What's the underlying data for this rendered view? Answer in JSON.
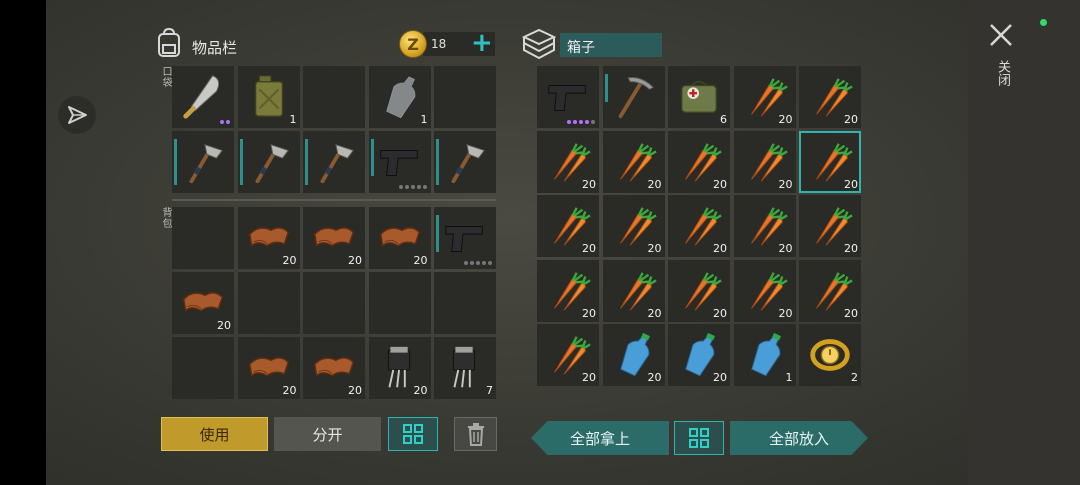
{
  "inventory": {
    "title": "物品栏",
    "coins": "18",
    "coin_symbol": "Z",
    "pocket_label": "口袋",
    "backpack_label": "背包",
    "pockets": [
      {
        "icon": "machete-icon",
        "dots": [
          "p",
          "p"
        ]
      },
      {
        "icon": "jerrycan-icon",
        "count": "1"
      },
      {
        "icon": "empty"
      },
      {
        "icon": "water-bottle-empty-icon",
        "count": "1"
      },
      {
        "icon": "empty"
      },
      {
        "icon": "hatchet-icon",
        "durability": 1.0
      },
      {
        "icon": "hatchet-icon",
        "durability": 1.0
      },
      {
        "icon": "hatchet-icon",
        "durability": 1.0
      },
      {
        "icon": "pistol-icon",
        "durability": 0.8,
        "dots": [
          "g",
          "g",
          "g",
          "g",
          "g"
        ]
      },
      {
        "icon": "hatchet-icon",
        "durability": 1.0
      }
    ],
    "backpack": [
      {
        "icon": "empty"
      },
      {
        "icon": "leather-icon",
        "count": "20"
      },
      {
        "icon": "leather-icon",
        "count": "20"
      },
      {
        "icon": "leather-icon",
        "count": "20"
      },
      {
        "icon": "pistol-icon",
        "durability": 0.8,
        "dots": [
          "g",
          "g",
          "g",
          "g",
          "g"
        ]
      },
      {
        "icon": "leather-icon",
        "count": "20"
      },
      {
        "icon": "empty"
      },
      {
        "icon": "empty"
      },
      {
        "icon": "empty"
      },
      {
        "icon": "empty"
      },
      {
        "icon": "empty"
      },
      {
        "icon": "leather-icon",
        "count": "20"
      },
      {
        "icon": "leather-icon",
        "count": "20"
      },
      {
        "icon": "transistor-icon",
        "count": "20"
      },
      {
        "icon": "transistor-icon",
        "count": "7"
      }
    ]
  },
  "box": {
    "title": "箱子",
    "slots": [
      {
        "icon": "pistol-icon",
        "dots": [
          "p",
          "p",
          "p",
          "p",
          "g"
        ]
      },
      {
        "icon": "pickaxe-icon",
        "durability": 0.6
      },
      {
        "icon": "medkit-bag-icon",
        "count": "6"
      },
      {
        "icon": "carrot-icon",
        "count": "20"
      },
      {
        "icon": "carrot-icon",
        "count": "20"
      },
      {
        "icon": "carrot-icon",
        "count": "20"
      },
      {
        "icon": "carrot-icon",
        "count": "20"
      },
      {
        "icon": "carrot-icon",
        "count": "20"
      },
      {
        "icon": "carrot-icon",
        "count": "20"
      },
      {
        "icon": "carrot-icon",
        "count": "20",
        "selected": true
      },
      {
        "icon": "carrot-icon",
        "count": "20"
      },
      {
        "icon": "carrot-icon",
        "count": "20"
      },
      {
        "icon": "carrot-icon",
        "count": "20"
      },
      {
        "icon": "carrot-icon",
        "count": "20"
      },
      {
        "icon": "carrot-icon",
        "count": "20"
      },
      {
        "icon": "carrot-icon",
        "count": "20"
      },
      {
        "icon": "carrot-icon",
        "count": "20"
      },
      {
        "icon": "carrot-icon",
        "count": "20"
      },
      {
        "icon": "carrot-icon",
        "count": "20"
      },
      {
        "icon": "carrot-icon",
        "count": "20"
      },
      {
        "icon": "carrot-icon",
        "count": "20"
      },
      {
        "icon": "water-bottle-icon",
        "count": "20"
      },
      {
        "icon": "water-bottle-icon",
        "count": "20"
      },
      {
        "icon": "water-bottle-icon",
        "count": "1"
      },
      {
        "icon": "gold-watch-icon",
        "count": "2"
      }
    ]
  },
  "buttons": {
    "use": "使用",
    "split": "分开",
    "take_all": "全部拿上",
    "put_all": "全部放入",
    "close": "关闭"
  },
  "colors": {
    "accent_teal": "#2fb3ad",
    "use_gold": "#c09a2a",
    "status_green": "#2ddc6a"
  }
}
